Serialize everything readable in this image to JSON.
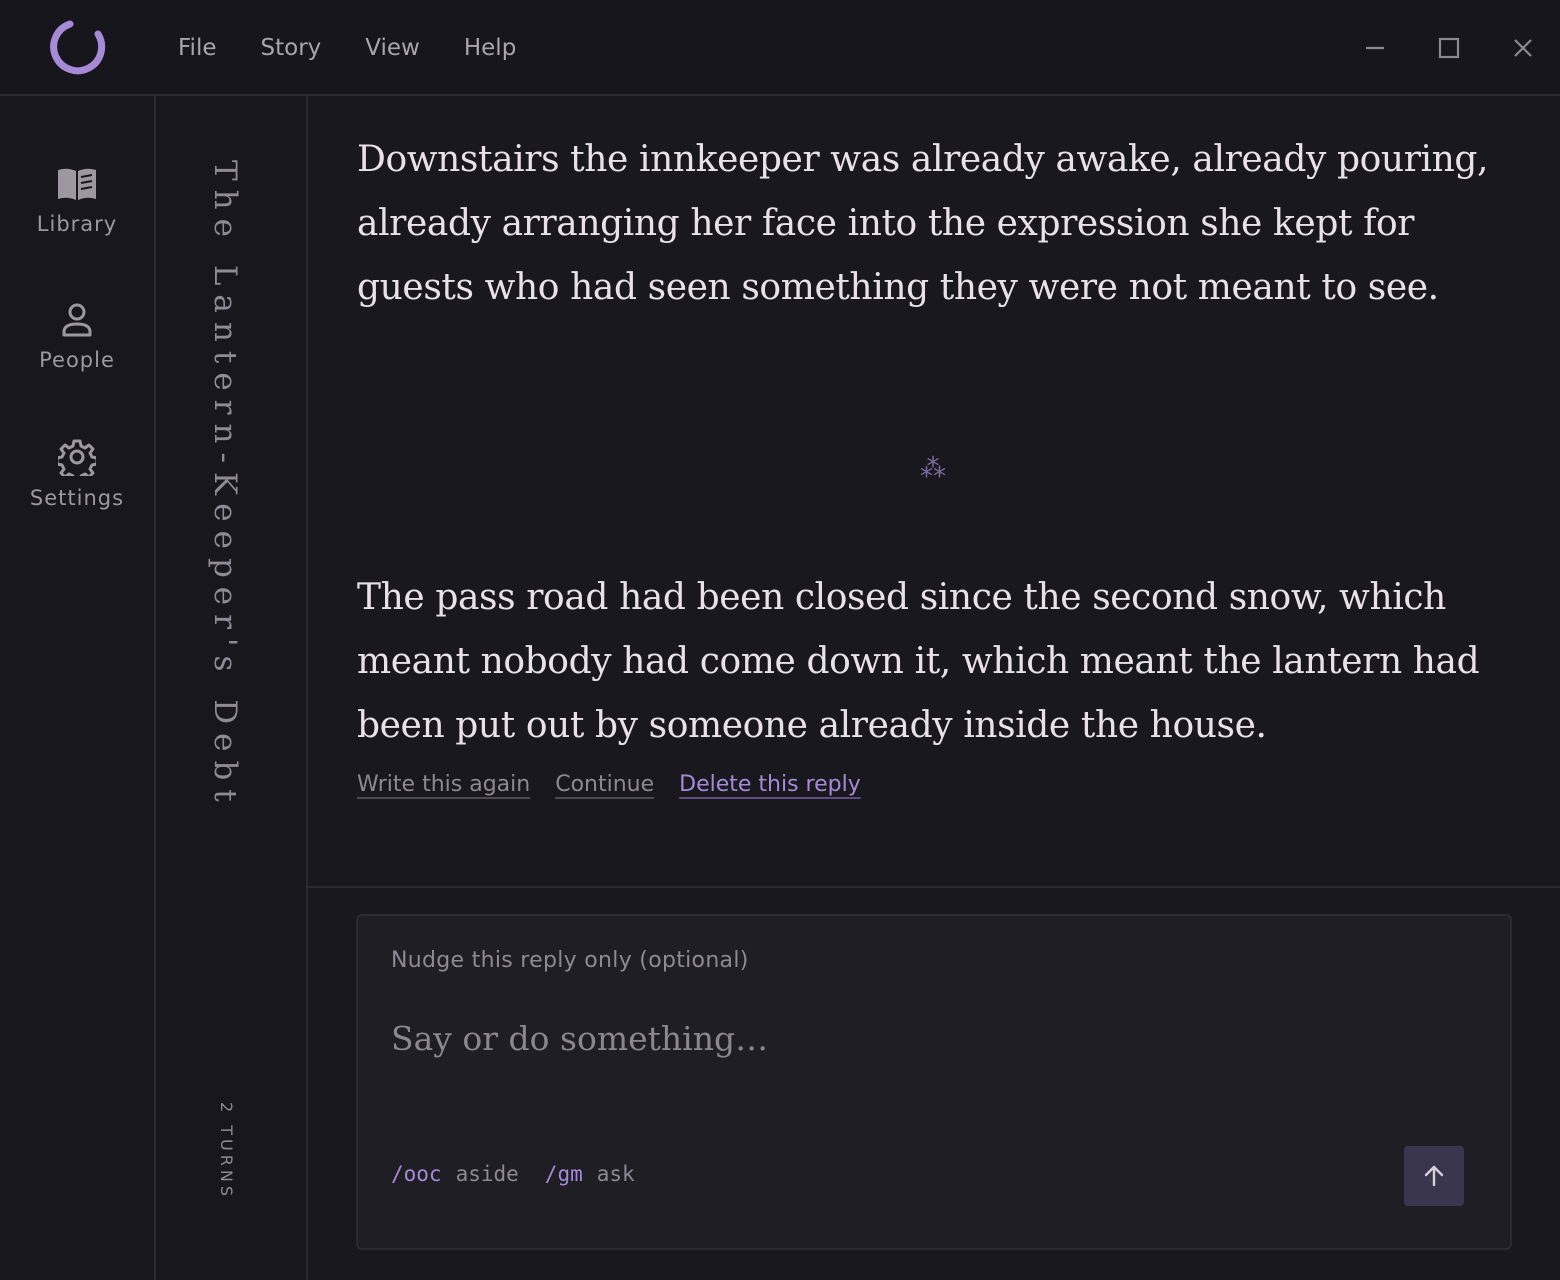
{
  "colors": {
    "background": "#17161c",
    "accent": "#a58ad6",
    "text": "#e6e2e8",
    "muted": "#8d8994"
  },
  "app": {
    "logo": "crescent-ring-logo"
  },
  "menu": {
    "items": [
      {
        "label": "File"
      },
      {
        "label": "Story"
      },
      {
        "label": "View"
      },
      {
        "label": "Help"
      }
    ]
  },
  "window_controls": {
    "minimize_icon": "minimize-icon",
    "maximize_icon": "maximize-icon",
    "close_icon": "close-icon"
  },
  "sidebar": {
    "items": [
      {
        "label": "Library",
        "icon": "book-icon"
      },
      {
        "label": "People",
        "icon": "person-icon"
      },
      {
        "label": "Settings",
        "icon": "gear-icon"
      }
    ]
  },
  "story": {
    "title": "The Lantern-Keeper's Debt",
    "turns": "2 TURNS"
  },
  "main": {
    "paragraphs": [
      "Downstairs the innkeeper was already awake, already pouring, already arranging her face into the expression she kept for guests who had seen something they were not meant to see.",
      "The pass road had been closed since the second snow, which meant nobody had come down it, which meant the lantern had been put out by someone already inside the house."
    ],
    "divider": "⁂",
    "actions": {
      "rewrite": "Write this again",
      "continue": "Continue",
      "delete": "Delete this reply"
    }
  },
  "composer": {
    "nudge_label": "Nudge this reply only (optional)",
    "input_value": "",
    "placeholder": "Say or do something…",
    "hints": [
      {
        "command": "/ooc",
        "description": "aside"
      },
      {
        "command": "/gm",
        "description": "ask"
      }
    ],
    "send_icon": "arrow-up-icon"
  }
}
